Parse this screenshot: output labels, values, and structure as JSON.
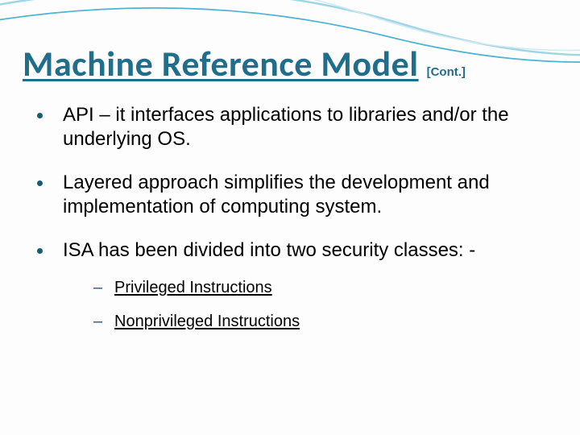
{
  "title": "Machine Reference Model",
  "cont_label": "[Cont.]",
  "bullets": [
    "API – it interfaces applications to libraries and/or the underlying OS.",
    "Layered approach simplifies the development and implementation of computing system.",
    "ISA has been divided into two security classes: -"
  ],
  "sub_bullets": [
    "Privileged Instructions",
    "Nonprivileged Instructions"
  ]
}
